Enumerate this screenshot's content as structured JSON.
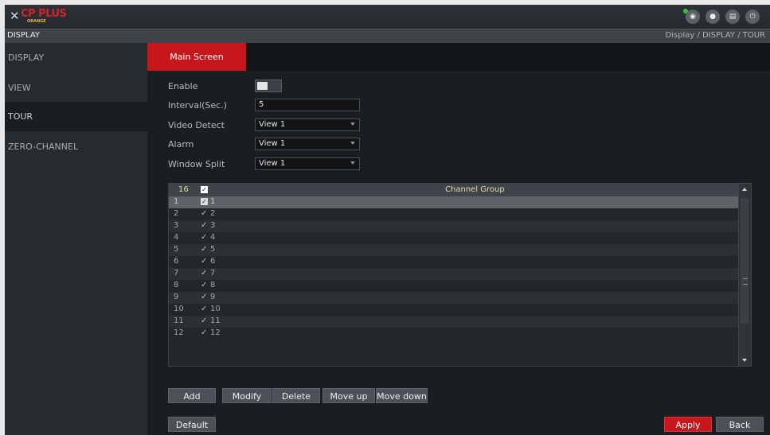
{
  "topbar": {
    "logo_text": "CP PLUS",
    "logo_sub": "ORANGE",
    "icons": [
      "preview-icon",
      "user-icon",
      "menu-grid-icon",
      "power-icon"
    ],
    "status_color": "#33c33c"
  },
  "page_title": "DISPLAY",
  "breadcrumb": "Display  /  DISPLAY  /  TOUR",
  "sidebar": {
    "items": [
      {
        "label": "DISPLAY"
      },
      {
        "label": "VIEW"
      },
      {
        "label": "TOUR",
        "active": true
      },
      {
        "label": "ZERO-CHANNEL"
      }
    ]
  },
  "tabs": [
    {
      "label": "Main Screen",
      "active": true
    }
  ],
  "form": {
    "enable_label": "Enable",
    "enable_state": false,
    "interval_label": "Interval(Sec.)",
    "interval_value": "5",
    "video_detect_label": "Video Detect",
    "video_detect_value": "View 1",
    "alarm_label": "Alarm",
    "alarm_value": "View 1",
    "window_split_label": "Window Split",
    "window_split_value": "View 1"
  },
  "table": {
    "header_count": "16",
    "header_group": "Channel Group",
    "rows": [
      {
        "num": "1",
        "check": "✓",
        "name": "1"
      },
      {
        "num": "2",
        "check": "✓",
        "name": "2"
      },
      {
        "num": "3",
        "check": "✓",
        "name": "3"
      },
      {
        "num": "4",
        "check": "✓",
        "name": "4"
      },
      {
        "num": "5",
        "check": "✓",
        "name": "5"
      },
      {
        "num": "6",
        "check": "✓",
        "name": "6"
      },
      {
        "num": "7",
        "check": "✓",
        "name": "7"
      },
      {
        "num": "8",
        "check": "✓",
        "name": "8"
      },
      {
        "num": "9",
        "check": "✓",
        "name": "9"
      },
      {
        "num": "10",
        "check": "✓",
        "name": "10"
      },
      {
        "num": "11",
        "check": "✓",
        "name": "11"
      },
      {
        "num": "12",
        "check": "✓",
        "name": "12"
      }
    ]
  },
  "buttons": {
    "add": "Add",
    "modify": "Modify",
    "delete": "Delete",
    "move_up": "Move up",
    "move_down": "Move down",
    "default": "Default",
    "apply": "Apply",
    "back": "Back"
  },
  "colors": {
    "accent": "#c8161d",
    "selected_row": "#5e6367"
  }
}
